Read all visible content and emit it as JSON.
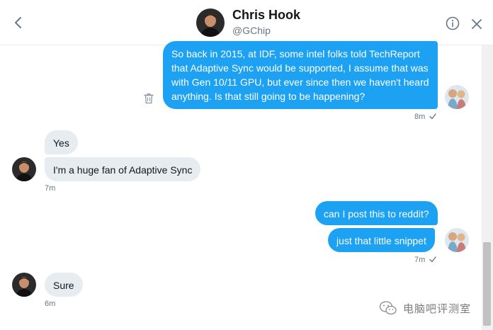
{
  "header": {
    "name": "Chris Hook",
    "handle": "@GChip"
  },
  "messages": [
    {
      "direction": "out",
      "lines": [
        "So back in 2015, at IDF, some intel folks told TechReport",
        "that Adaptive Sync would be supported, I assume that was",
        "with Gen 10/11 GPU, but ever since then we haven't heard",
        "anything. Is that still going to be happening?"
      ],
      "time": "8m",
      "read": true
    },
    {
      "direction": "in",
      "text": "Yes"
    },
    {
      "direction": "in",
      "text": "I'm a huge fan of Adaptive Sync",
      "time": "7m"
    },
    {
      "direction": "out",
      "text": "can I post this to reddit?"
    },
    {
      "direction": "out",
      "text": "just that little snippet",
      "time": "7m",
      "read": true
    },
    {
      "direction": "in",
      "text": "Sure",
      "time": "6m"
    }
  ],
  "watermark": {
    "text": "电脑吧评测室"
  },
  "colors": {
    "outgoing_bubble": "#1da1f2",
    "incoming_bubble": "#e6ecf0",
    "meta_text": "#657786"
  },
  "icons": {
    "back": "chevron-left-icon",
    "info": "info-icon",
    "close": "close-icon",
    "delete": "trash-icon",
    "read_receipt": "checkmark-icon",
    "watermark": "wechat-logo-icon"
  }
}
